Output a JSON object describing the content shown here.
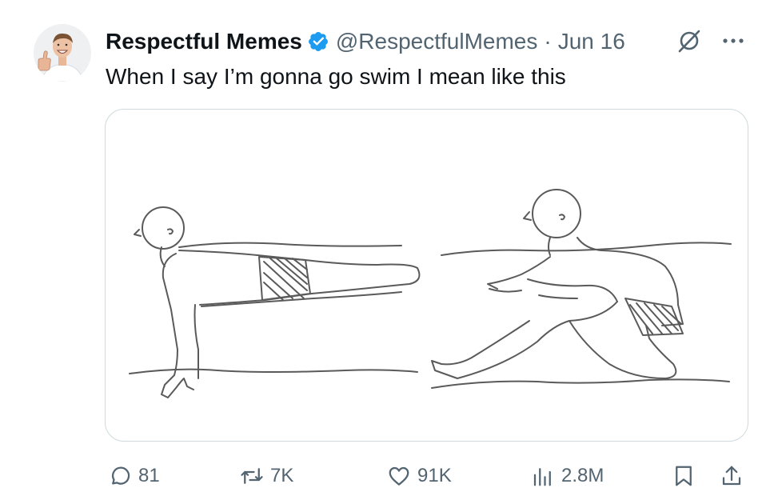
{
  "tweet": {
    "author": {
      "name": "Respectful Memes",
      "handle": "@RespectfulMemes",
      "verified": true,
      "verified_color": "#1d9bf0"
    },
    "separator": "·",
    "date": "Jun 16",
    "text": "When I say I’m gonna go swim I mean like this",
    "header_icons": [
      "grok-icon",
      "more-icon"
    ],
    "media": {
      "panels": 2
    },
    "stats": {
      "replies": "81",
      "reposts": "7K",
      "likes": "91K",
      "views": "2.8M"
    }
  },
  "colors": {
    "text_primary": "#0f1419",
    "text_secondary": "#536471",
    "border": "#cfd9de",
    "accent": "#1d9bf0"
  }
}
